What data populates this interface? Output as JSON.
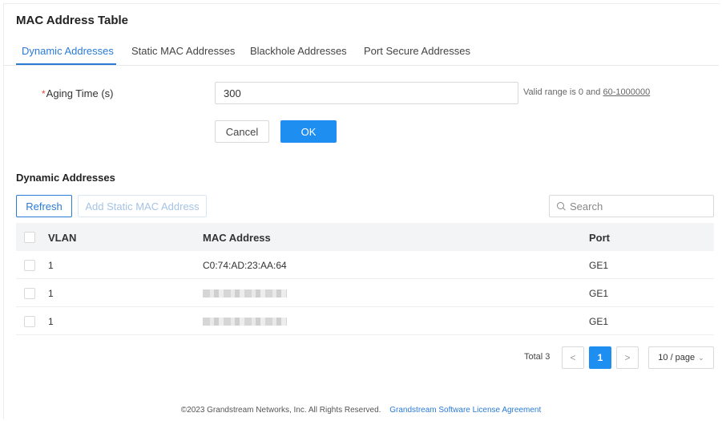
{
  "page": {
    "title": "MAC Address Table"
  },
  "tabs": [
    {
      "label": "Dynamic Addresses"
    },
    {
      "label": "Static MAC Addresses"
    },
    {
      "label": "Blackhole Addresses"
    },
    {
      "label": "Port Secure Addresses"
    }
  ],
  "active_tab": "Dynamic Addresses",
  "form": {
    "required_mark": "*",
    "aging_label": "Aging Time (s)",
    "aging_value": "300",
    "hint_prefix": "Valid range is 0 and ",
    "hint_range": "60-1000000",
    "cancel_label": "Cancel",
    "ok_label": "OK"
  },
  "section": {
    "title": "Dynamic Addresses",
    "refresh_label": "Refresh",
    "add_label": "Add Static MAC Address",
    "search_placeholder": "Search"
  },
  "table": {
    "columns": [
      "VLAN",
      "MAC Address",
      "Port"
    ],
    "rows": [
      {
        "vlan": "1",
        "mac": "C0:74:AD:23:AA:64",
        "port": "GE1"
      },
      {
        "vlan": "1",
        "mac": "",
        "port": "GE1"
      },
      {
        "vlan": "1",
        "mac": "",
        "port": "GE1"
      }
    ]
  },
  "pagination": {
    "total": "Total 3",
    "prev": "<",
    "current": "1",
    "next": ">",
    "page_size": "10 / page"
  },
  "footer": {
    "copyright": "©2023 Grandstream Networks, Inc. All Rights Reserved.",
    "link": "Grandstream Software License Agreement"
  },
  "colors": {
    "accent": "#1e8ef0",
    "required": "#e5483a"
  }
}
